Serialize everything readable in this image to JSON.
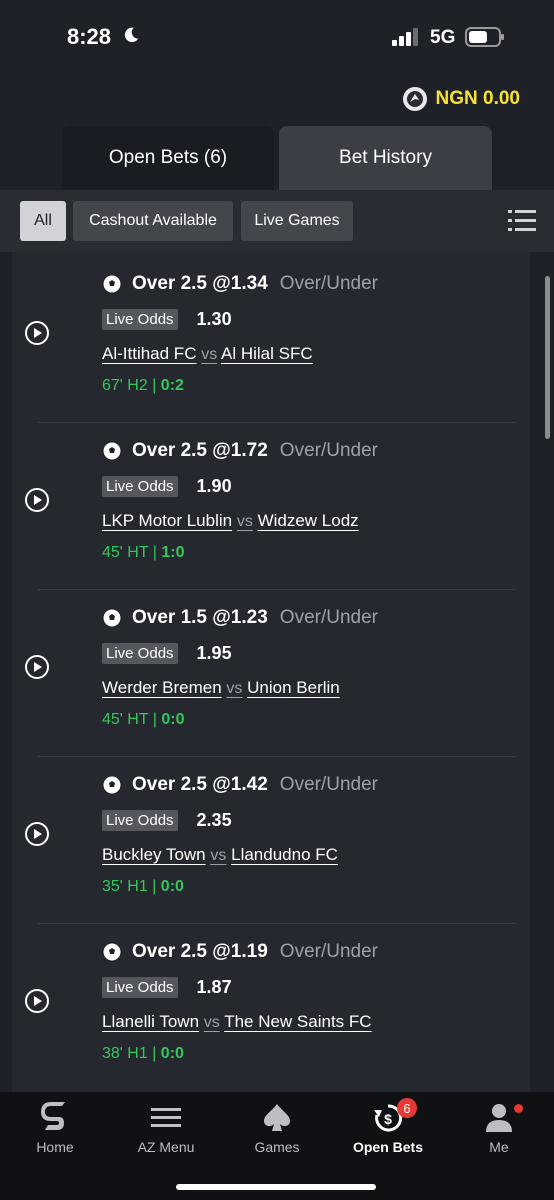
{
  "status_bar": {
    "time": "8:28",
    "network": "5G"
  },
  "balance": {
    "amount": "NGN 0.00"
  },
  "tabs": {
    "open_bets": "Open Bets (6)",
    "bet_history": "Bet History"
  },
  "filters": {
    "all": "All",
    "cashout": "Cashout Available",
    "live_games": "Live Games"
  },
  "bets": [
    {
      "selection": "Over 2.5 @1.34",
      "market": "Over/Under",
      "live_label": "Live Odds",
      "live_odds": "1.30",
      "home": "Al-Ittihad FC",
      "vs": "vs",
      "away": "Al Hilal SFC",
      "time": "67' H2 | ",
      "score": "0:2"
    },
    {
      "selection": "Over 2.5 @1.72",
      "market": "Over/Under",
      "live_label": "Live Odds",
      "live_odds": "1.90",
      "home": "LKP Motor Lublin",
      "vs": "vs",
      "away": "Widzew Lodz",
      "time": "45' HT | ",
      "score": "1:0"
    },
    {
      "selection": "Over 1.5 @1.23",
      "market": "Over/Under",
      "live_label": "Live Odds",
      "live_odds": "1.95",
      "home": "Werder Bremen",
      "vs": "vs",
      "away": "Union Berlin",
      "time": "45' HT | ",
      "score": "0:0"
    },
    {
      "selection": "Over 2.5 @1.42",
      "market": "Over/Under",
      "live_label": "Live Odds",
      "live_odds": "2.35",
      "home": "Buckley Town",
      "vs": "vs",
      "away": "Llandudno FC",
      "time": "35' H1 | ",
      "score": "0:0"
    },
    {
      "selection": "Over 2.5 @1.19",
      "market": "Over/Under",
      "live_label": "Live Odds",
      "live_odds": "1.87",
      "home": "Llanelli Town",
      "vs": "vs",
      "away": "The New Saints FC",
      "time": "38' H1 | ",
      "score": "0:0"
    }
  ],
  "bottom_nav": [
    {
      "label": "Home",
      "icon": "sporty-logo-icon"
    },
    {
      "label": "AZ Menu",
      "icon": "menu-icon"
    },
    {
      "label": "Games",
      "icon": "spade-icon"
    },
    {
      "label": "Open Bets",
      "icon": "open-bets-icon",
      "badge": "6"
    },
    {
      "label": "Me",
      "icon": "user-icon"
    }
  ],
  "colors": {
    "balance": "#f6e232",
    "live_green": "#34c759",
    "badge_red": "#e53935"
  }
}
